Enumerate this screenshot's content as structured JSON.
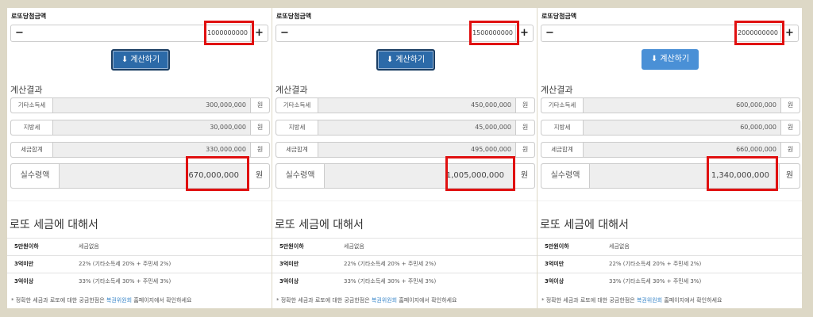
{
  "panels": [
    {
      "title": "로또당첨금액",
      "minus": "−",
      "plus": "+",
      "amount": "1000000000",
      "calc_button": {
        "icon": "⬇",
        "label": "계산하기",
        "style": "dark"
      },
      "result_heading": "계산결과",
      "rows": [
        {
          "label": "기타소득세",
          "value": "300,000,000",
          "unit": "원"
        },
        {
          "label": "지방세",
          "value": "30,000,000",
          "unit": "원"
        },
        {
          "label": "세금합계",
          "value": "330,000,000",
          "unit": "원"
        }
      ],
      "net": {
        "label": "실수령액",
        "value": "670,000,000",
        "unit": "원"
      },
      "info_heading": "로또 세금에 대해서",
      "tax_table": [
        {
          "k": "5만원이하",
          "v": "세금없음"
        },
        {
          "k": "3억미만",
          "v": "22% (기타소득세 20% + 주민세 2%)"
        },
        {
          "k": "3억이상",
          "v": "33% (기타소득세 30% + 주민세 3%)"
        }
      ],
      "note": {
        "before": "* 정확한 세금과 로또에 대한 궁금한점은 ",
        "link": "복권위원회",
        "after": " 홈페이지에서 확인하세요"
      }
    },
    {
      "title": "로또당첨금액",
      "minus": "−",
      "plus": "+",
      "amount": "1500000000",
      "calc_button": {
        "icon": "⬇",
        "label": "계산하기",
        "style": "dark"
      },
      "result_heading": "계산결과",
      "rows": [
        {
          "label": "기타소득세",
          "value": "450,000,000",
          "unit": "원"
        },
        {
          "label": "지방세",
          "value": "45,000,000",
          "unit": "원"
        },
        {
          "label": "세금합계",
          "value": "495,000,000",
          "unit": "원"
        }
      ],
      "net": {
        "label": "실수령액",
        "value": "1,005,000,000",
        "unit": "원"
      },
      "info_heading": "로또 세금에 대해서",
      "tax_table": [
        {
          "k": "5만원이하",
          "v": "세금없음"
        },
        {
          "k": "3억미만",
          "v": "22% (기타소득세 20% + 주민세 2%)"
        },
        {
          "k": "3억이상",
          "v": "33% (기타소득세 30% + 주민세 3%)"
        }
      ],
      "note": {
        "before": "* 정확한 세금과 로또에 대한 궁금한점은 ",
        "link": "복권위원회",
        "after": " 홈페이지에서 확인하세요"
      }
    },
    {
      "title": "로또당첨금액",
      "minus": "−",
      "plus": "+",
      "amount": "2000000000",
      "calc_button": {
        "icon": "⬇",
        "label": "계산하기",
        "style": "light"
      },
      "result_heading": "계산결과",
      "rows": [
        {
          "label": "기타소득세",
          "value": "600,000,000",
          "unit": "원"
        },
        {
          "label": "지방세",
          "value": "60,000,000",
          "unit": "원"
        },
        {
          "label": "세금합계",
          "value": "660,000,000",
          "unit": "원"
        }
      ],
      "net": {
        "label": "실수령액",
        "value": "1,340,000,000",
        "unit": "원"
      },
      "info_heading": "로또 세금에 대해서",
      "tax_table": [
        {
          "k": "5만원이하",
          "v": "세금없음"
        },
        {
          "k": "3억미만",
          "v": "22% (기타소득세 20% + 주민세 2%)"
        },
        {
          "k": "3억이상",
          "v": "33% (기타소득세 30% + 주민세 3%)"
        }
      ],
      "note": {
        "before": "* 정확한 세금과 로또에 대한 궁금한점은 ",
        "link": "복권위원회",
        "after": " 홈페이지에서 확인하세요"
      }
    }
  ],
  "colors": {
    "highlight": "#e01010",
    "button_dark": "#2c6aa8",
    "button_light": "#4a90d6",
    "link": "#3a87c9"
  }
}
